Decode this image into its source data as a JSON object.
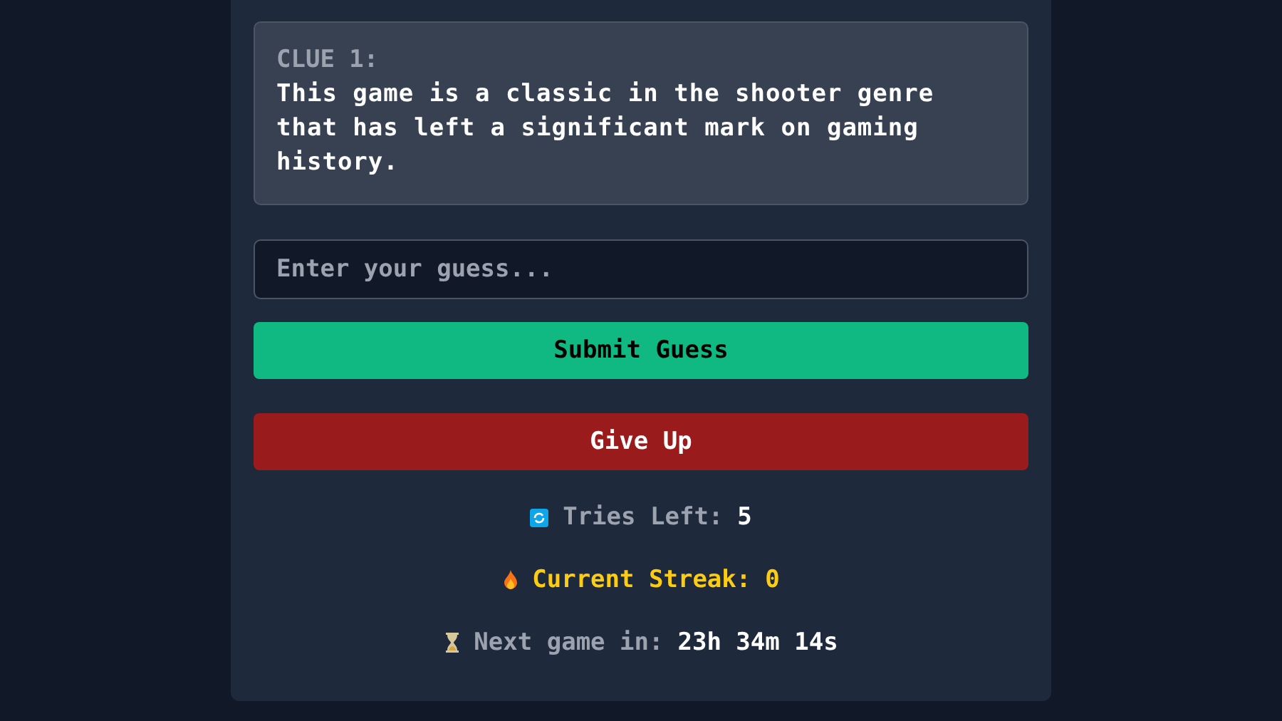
{
  "clue": {
    "label": "CLUE 1:",
    "text": "This game is a classic in the shooter genre that has left a significant mark on gaming history."
  },
  "guess": {
    "placeholder": "Enter your guess..."
  },
  "buttons": [
    {
      "label": "Submit Guess",
      "kind": "submit"
    },
    {
      "label": "Give Up",
      "kind": "giveup"
    }
  ],
  "stats": [
    {
      "kind": "tries",
      "label": "Tries Left:",
      "value": "5"
    },
    {
      "kind": "streak",
      "label": "Current Streak:",
      "value": "0"
    },
    {
      "kind": "timer",
      "label": "Next game in:",
      "value": "23h 34m 14s"
    }
  ]
}
